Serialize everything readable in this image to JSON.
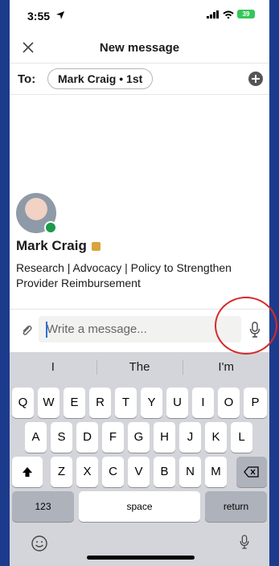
{
  "status": {
    "time": "3:55",
    "battery": "39"
  },
  "header": {
    "title": "New message"
  },
  "to": {
    "label": "To:",
    "recipient": "Mark Craig • 1st"
  },
  "profile": {
    "name": "Mark Craig",
    "headline": "Research | Advocacy | Policy to Strengthen Provider Reimbursement"
  },
  "composer": {
    "placeholder": "Write a message..."
  },
  "keyboard": {
    "suggestions": [
      "I",
      "The",
      "I'm"
    ],
    "row1": [
      "Q",
      "W",
      "E",
      "R",
      "T",
      "Y",
      "U",
      "I",
      "O",
      "P"
    ],
    "row2": [
      "A",
      "S",
      "D",
      "F",
      "G",
      "H",
      "J",
      "K",
      "L"
    ],
    "row3": [
      "Z",
      "X",
      "C",
      "V",
      "B",
      "N",
      "M"
    ],
    "numbers_label": "123",
    "space_label": "space",
    "return_label": "return"
  },
  "colors": {
    "accent": "#2f6fd6",
    "presence": "#1a9a4a",
    "annotation": "#d62a2a"
  },
  "icons": {
    "close": "close-icon",
    "add": "plus-circle-icon",
    "attach": "paperclip-icon",
    "mic": "microphone-icon",
    "shift": "shift-icon",
    "delete": "backspace-icon",
    "emoji": "emoji-icon"
  }
}
